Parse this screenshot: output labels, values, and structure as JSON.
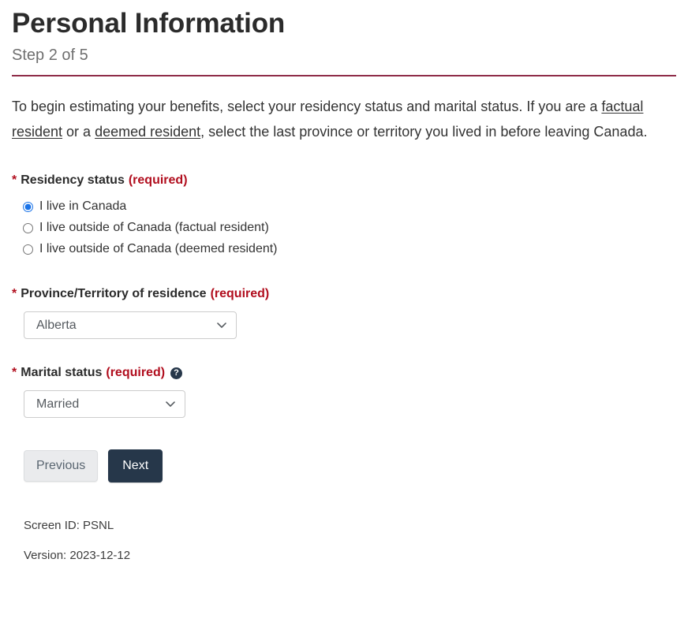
{
  "header": {
    "title": "Personal Information",
    "step": "Step 2 of 5"
  },
  "intro": {
    "part1": "To begin estimating your benefits, select your residency status and marital status. If you are a ",
    "link1": "factual resident",
    "part2": " or a ",
    "link2": "deemed resident",
    "part3": ", select the last province or territory you lived in before leaving Canada."
  },
  "residency": {
    "star": "*",
    "label": "Residency status",
    "required": "(required)",
    "options": [
      {
        "label": "I live in Canada",
        "selected": true
      },
      {
        "label": "I live outside of Canada (factual resident)",
        "selected": false
      },
      {
        "label": "I live outside of Canada (deemed resident)",
        "selected": false
      }
    ]
  },
  "province": {
    "star": "*",
    "label": "Province/Territory of residence",
    "required": "(required)",
    "value": "Alberta",
    "chevron_icon": "chevron-down-icon"
  },
  "marital": {
    "star": "*",
    "label": "Marital status",
    "required": "(required)",
    "help_icon": "help-circle-icon",
    "help_glyph": "?",
    "value": "Married",
    "chevron_icon": "chevron-down-icon"
  },
  "buttons": {
    "previous": "Previous",
    "next": "Next"
  },
  "meta": {
    "screen_id": "Screen ID: PSNL",
    "version": "Version: 2023-12-12"
  },
  "colors": {
    "rule": "#8f2c48",
    "required_red": "#b10e1e",
    "next_button": "#26374a",
    "radio_accent": "#1a73e8"
  }
}
